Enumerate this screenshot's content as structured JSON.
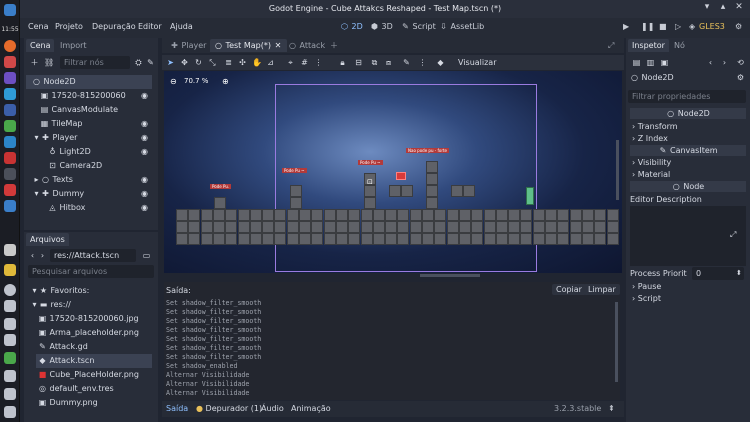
{
  "window": {
    "title": "Godot Engine - Cube Attakcs Reshaped - Test Map.tscn (*)"
  },
  "system": {
    "clock": "11:55"
  },
  "menu": [
    "Cena",
    "Projeto",
    "Depuração",
    "Editor",
    "Ajuda"
  ],
  "workspaces": {
    "view2d": "2D",
    "view3d": "3D",
    "script": "Script",
    "assetlib": "AssetLib"
  },
  "renderer": "GLES3",
  "scene_dock": {
    "tabs": [
      "Cena",
      "Import"
    ],
    "filter_placeholder": "Filtrar nós",
    "nodes": [
      {
        "label": "Node2D",
        "icon": "node2d-icon",
        "selected": true
      },
      {
        "label": "17520-815200060",
        "icon": "sprite-icon"
      },
      {
        "label": "CanvasModulate",
        "icon": "canvasmodulate-icon"
      },
      {
        "label": "TileMap",
        "icon": "tilemap-icon"
      },
      {
        "label": "Player",
        "icon": "kinematic-icon"
      },
      {
        "label": "Light2D",
        "icon": "light-icon"
      },
      {
        "label": "Camera2D",
        "icon": "camera-icon"
      },
      {
        "label": "Texts",
        "icon": "node2d-icon"
      },
      {
        "label": "Dummy",
        "icon": "kinematic-icon"
      },
      {
        "label": "Hitbox",
        "icon": "area-icon"
      }
    ]
  },
  "filesystem": {
    "tab": "Arquivos",
    "path": "res://Attack.tscn",
    "search_placeholder": "Pesquisar arquivos",
    "favorites": "Favoritos:",
    "root": "res://",
    "files": [
      {
        "name": "17520-815200060.jpg",
        "icon": "image-icon"
      },
      {
        "name": "Arma_placeholder.png",
        "icon": "image-icon"
      },
      {
        "name": "Attack.gd",
        "icon": "script-icon"
      },
      {
        "name": "Attack.tscn",
        "icon": "scene-icon",
        "selected": true
      },
      {
        "name": "Cube_PlaceHolder.png",
        "icon": "image-icon"
      },
      {
        "name": "default_env.tres",
        "icon": "resource-icon"
      },
      {
        "name": "Dummy.png",
        "icon": "image-icon"
      }
    ]
  },
  "editor_tabs": [
    {
      "label": "Player",
      "active": false
    },
    {
      "label": "Test Map(*)",
      "active": true
    },
    {
      "label": "Attack",
      "active": false
    }
  ],
  "toolbar": {
    "view_label": "Visualizar"
  },
  "viewport": {
    "zoom": "70.7 %",
    "labels": [
      "Pode Pu.",
      "Pode Pu ~",
      "Pode Pu ~",
      "Nao pode pu - forte"
    ]
  },
  "output": {
    "title": "Saída:",
    "copy_label": "Copiar",
    "clear_label": "Limpar",
    "lines": [
      "Set shadow_filter_smooth",
      "Set shadow_filter_smooth",
      "Set shadow_filter_smooth",
      "Set shadow_filter_smooth",
      "Set shadow_filter_smooth",
      "Set shadow_filter_smooth",
      "Set shadow_filter_smooth",
      "Set shadow_enabled",
      "Alternar Visibilidade",
      "Alternar Visibilidade",
      "Alternar Visibilidade"
    ]
  },
  "bottom_tabs": {
    "output": "Saída",
    "debugger": "Depurador (1)",
    "audio": "Áudio",
    "animation": "Animação"
  },
  "version": "3.2.3.stable",
  "inspector": {
    "tabs": [
      "Inspetor",
      "Nó"
    ],
    "object": "Node2D",
    "filter_placeholder": "Filtrar propriedades",
    "class_header": "Node2D",
    "sections": [
      "Transform",
      "Z Index"
    ],
    "canvas_header": "CanvasItem",
    "canvas_sections": [
      "Visibility",
      "Material"
    ],
    "node_header": "Node",
    "editor_description": "Editor Description",
    "process_priority_label": "Process Priorit",
    "process_priority_value": "0",
    "node_sections": [
      "Pause",
      "Script"
    ]
  },
  "colors": {
    "accent": "#8fc0ff",
    "renderer": "#e8c05a",
    "selection": "#3b4253"
  }
}
